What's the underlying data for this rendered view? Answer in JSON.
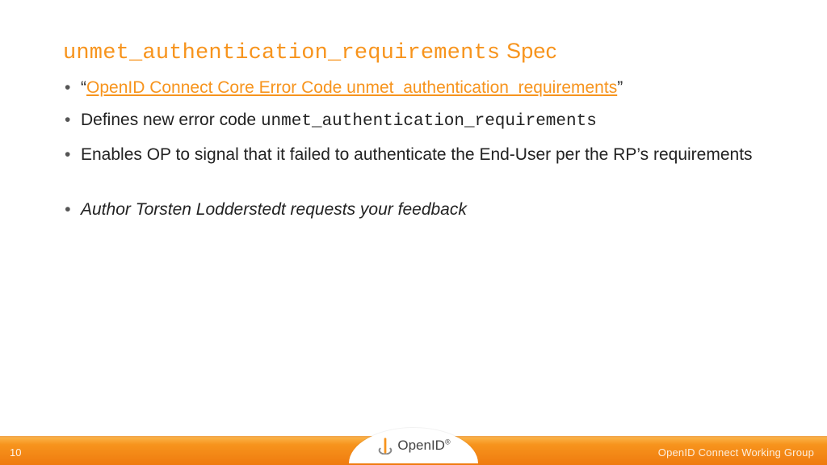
{
  "title": {
    "code": "unmet_authentication_requirements",
    "suffix": " Spec"
  },
  "bullets": [
    {
      "type": "link",
      "prefix": "“",
      "link": "OpenID Connect Core Error Code unmet_authentication_requirements",
      "suffix": "”"
    },
    {
      "type": "code",
      "text": "Defines new error code ",
      "code": "unmet_authentication_requirements"
    },
    {
      "type": "plain",
      "text": "Enables OP to signal that it failed to authenticate the End-User per the RP’s requirements"
    },
    {
      "type": "italic",
      "text": "Author Torsten Lodderstedt requests your feedback"
    }
  ],
  "footer": {
    "page": "10",
    "group": "OpenID Connect Working Group",
    "logo": "OpenID"
  }
}
